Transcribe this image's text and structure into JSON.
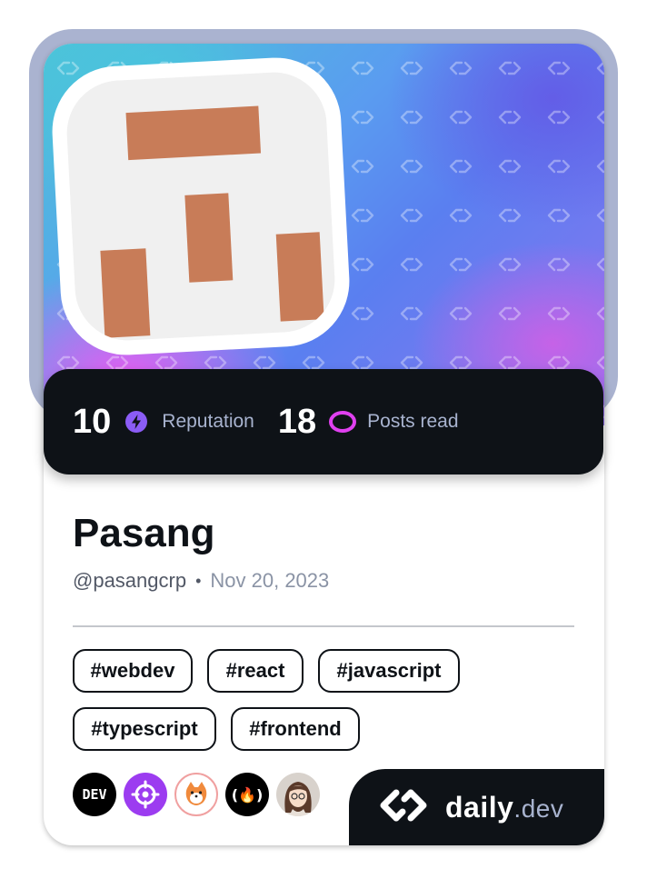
{
  "profile": {
    "name": "Pasang",
    "handle": "@pasangcrp",
    "separator": "•",
    "joined": "Nov 20, 2023"
  },
  "stats": {
    "reputation_value": "10",
    "reputation_label": "Reputation",
    "posts_value": "18",
    "posts_label": "Posts read"
  },
  "tags": [
    "#webdev",
    "#react",
    "#javascript",
    "#typescript",
    "#frontend"
  ],
  "sources": [
    {
      "name": "dev-to-icon",
      "label": "DEV"
    },
    {
      "name": "target-icon"
    },
    {
      "name": "shiba-icon"
    },
    {
      "name": "freecodecamp-icon",
      "label": "(🔥)"
    },
    {
      "name": "anime-girl-avatar-icon"
    }
  ],
  "brand": {
    "name": "daily",
    "suffix": ".dev"
  },
  "colors": {
    "dark": "#0e1217",
    "reputation_icon": "#8b5cf6",
    "posts_icon": "#e040f0",
    "avatar_block": "#c87c58"
  }
}
